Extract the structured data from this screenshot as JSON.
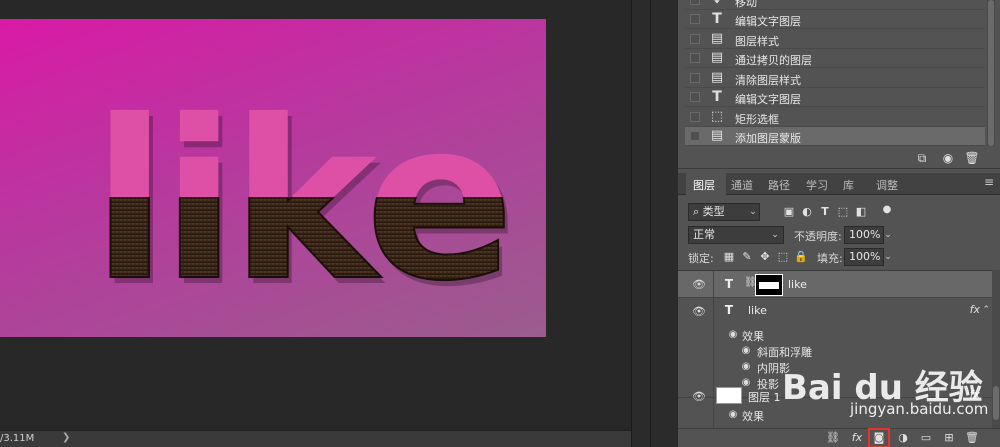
{
  "canvas": {
    "artwork_text": "like"
  },
  "status": {
    "doc_size": "/3.11M",
    "arrow": "❯"
  },
  "history": {
    "items": [
      {
        "icon": "move-icon",
        "label": "移动",
        "glyph": "✥"
      },
      {
        "icon": "type-icon",
        "label": "编辑文字图层",
        "glyph": "T"
      },
      {
        "icon": "document-icon",
        "label": "图层样式",
        "glyph": "▤"
      },
      {
        "icon": "document-icon",
        "label": "通过拷贝的图层",
        "glyph": "▤"
      },
      {
        "icon": "document-icon",
        "label": "清除图层样式",
        "glyph": "▤"
      },
      {
        "icon": "type-icon",
        "label": "编辑文字图层",
        "glyph": "T"
      },
      {
        "icon": "marquee-icon",
        "label": "矩形选框",
        "glyph": "⬚"
      },
      {
        "icon": "document-icon",
        "label": "添加图层蒙版",
        "glyph": "▤"
      }
    ]
  },
  "layers_panel": {
    "tabs": [
      "图层",
      "通道",
      "路径",
      "学习",
      "库",
      "调整"
    ],
    "filter": {
      "label": "类型",
      "icon": "search-icon"
    },
    "blend_mode": "正常",
    "opacity_label": "不透明度:",
    "opacity_value": "100%",
    "lock_label": "锁定:",
    "fill_label": "填充:",
    "fill_value": "100%",
    "layers": [
      {
        "name": "like",
        "type_glyph": "T",
        "selected": true,
        "has_mask": true
      },
      {
        "name": "like",
        "type_glyph": "T",
        "selected": false,
        "fx": "fx"
      },
      {
        "name": "图层 1",
        "selected": false,
        "fx": "fx"
      }
    ],
    "effects_label": "效果",
    "effects": [
      "斜面和浮雕",
      "内阴影",
      "投影"
    ],
    "layer1_effects_label": "效果"
  },
  "watermark": {
    "brand": "Bai du 经验",
    "url": "jingyan.baidu.com"
  },
  "colors": {
    "accent_highlight": "#e8332c",
    "panel_bg": "#535353",
    "canvas_bg": "#282828",
    "artwork_pink": "#de4fa6",
    "artwork_brown": "#3a2416"
  }
}
